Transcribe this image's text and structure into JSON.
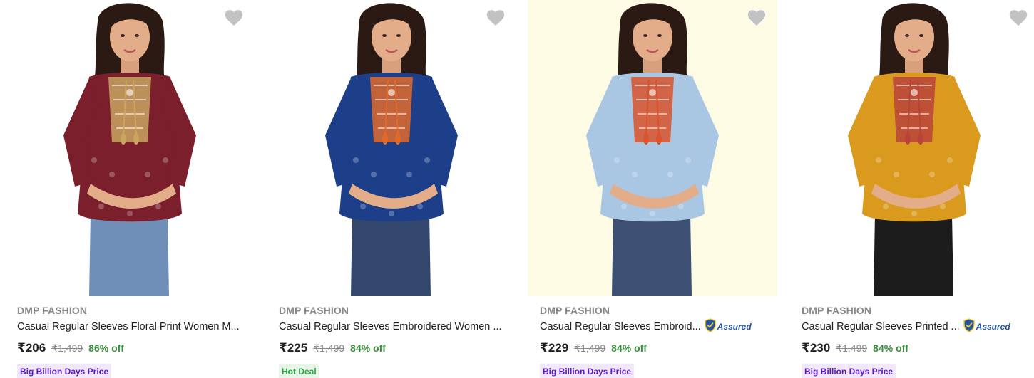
{
  "products": [
    {
      "brand": "DMP FASHION",
      "title": "Casual Regular Sleeves Floral Print Women M...",
      "assured": false,
      "price": "₹206",
      "mrp": "₹1,499",
      "discount": "86% off",
      "tag": "Big Billion Days Price",
      "tag_type": "bbd",
      "image_bg": "#ffffff",
      "top_color": "#7a1f2b",
      "accent_color": "#c9a463",
      "bottom_color": "#6f8fb8",
      "wishlist_icon": "heart-icon"
    },
    {
      "brand": "DMP FASHION",
      "title": "Casual Regular Sleeves Embroidered Women ...",
      "assured": false,
      "price": "₹225",
      "mrp": "₹1,499",
      "discount": "84% off",
      "tag": "Hot Deal",
      "tag_type": "hot",
      "image_bg": "#ffffff",
      "top_color": "#1d3f8a",
      "accent_color": "#e06a2a",
      "bottom_color": "#33466b",
      "wishlist_icon": "heart-icon"
    },
    {
      "brand": "DMP FASHION",
      "title": "Casual Regular Sleeves Embroid...",
      "assured": true,
      "assured_label": "Assured",
      "price": "₹229",
      "mrp": "₹1,499",
      "discount": "84% off",
      "tag": "Big Billion Days Price",
      "tag_type": "bbd",
      "image_bg": "#fdfbe4",
      "top_color": "#a9c6e3",
      "accent_color": "#d9532c",
      "bottom_color": "#3d4f72",
      "wishlist_icon": "heart-icon"
    },
    {
      "brand": "DMP FASHION",
      "title": "Casual Regular Sleeves Printed ...",
      "assured": true,
      "assured_label": "Assured",
      "price": "₹230",
      "mrp": "₹1,499",
      "discount": "84% off",
      "tag": "Big Billion Days Price",
      "tag_type": "bbd",
      "image_bg": "#ffffff",
      "top_color": "#d99a1e",
      "accent_color": "#b8433a",
      "bottom_color": "#1c1c1c",
      "wishlist_icon": "heart-icon"
    }
  ]
}
